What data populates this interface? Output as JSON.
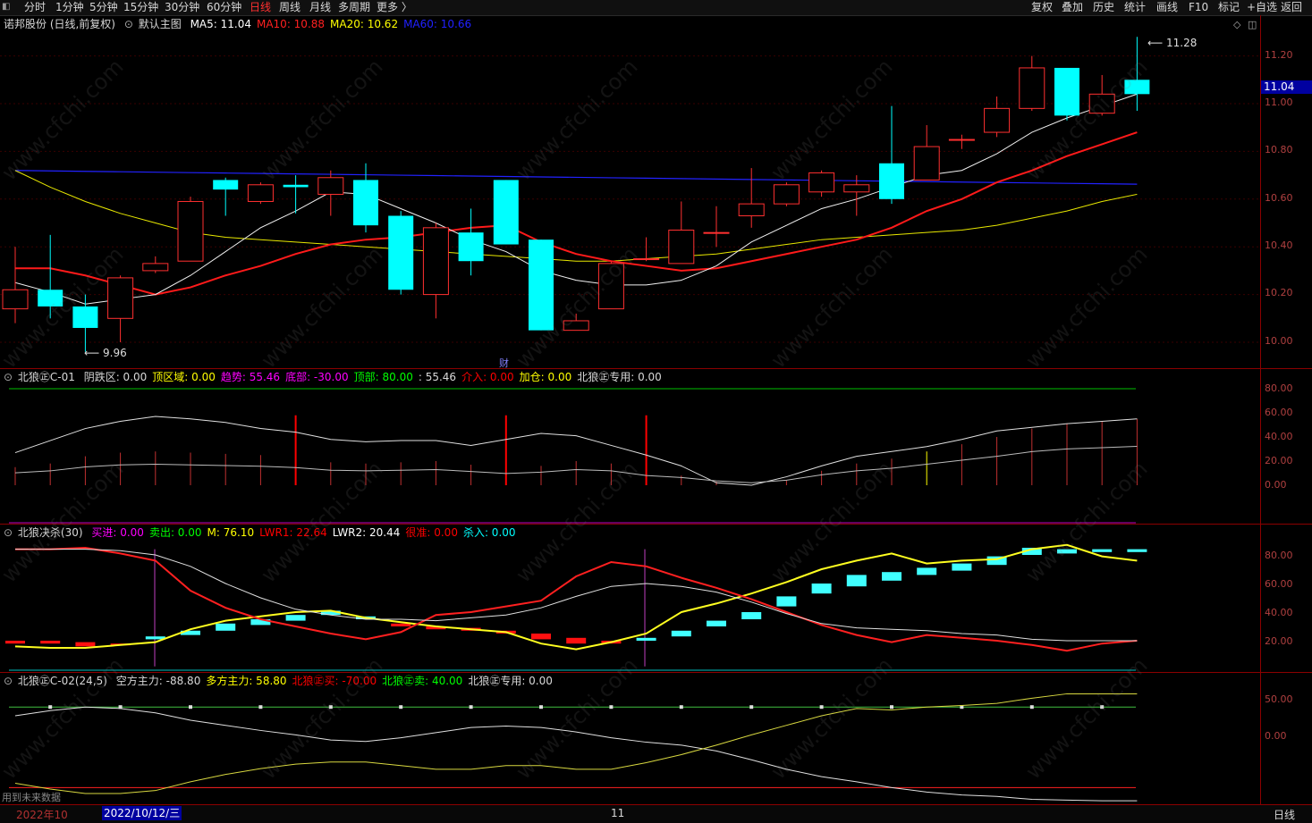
{
  "toolbar": {
    "periods": [
      "分时",
      "1分钟",
      "5分钟",
      "15分钟",
      "30分钟",
      "60分钟",
      "日线",
      "周线",
      "月线",
      "多周期",
      "更多 〉"
    ],
    "active_period": "日线",
    "right": [
      "复权",
      "叠加",
      "历史",
      "统计",
      "画线",
      "F10",
      "标记",
      "+自选",
      "返回"
    ]
  },
  "main": {
    "stock": "诺邦股份 (日线,前复权)",
    "template": "默认主图",
    "ma": [
      {
        "label": "MA5: 11.04",
        "color": "#ffffff"
      },
      {
        "label": "MA10: 10.88",
        "color": "#ff2020"
      },
      {
        "label": "MA20: 10.62",
        "color": "#ffff00"
      },
      {
        "label": "MA60: 10.66",
        "color": "#2020ff"
      }
    ],
    "y_ticks": [
      "11.20",
      "11.00",
      "10.80",
      "10.60",
      "10.40",
      "10.20",
      "10.00"
    ],
    "current_price": "11.04",
    "high_label": "11.28",
    "low_label": "9.96",
    "marker": "财"
  },
  "ind1": {
    "name": "北狼㊣C-01",
    "legend": [
      {
        "t": "阴跌区: 0.00",
        "c": "#d8d8d8"
      },
      {
        "t": "顶区域: 0.00",
        "c": "#ffff00"
      },
      {
        "t": "趋势: 55.46",
        "c": "#ff00ff"
      },
      {
        "t": "底部: -30.00",
        "c": "#ff00ff"
      },
      {
        "t": "顶部: 80.00",
        "c": "#00ff00"
      },
      {
        "t": ": 55.46",
        "c": "#d8d8d8"
      },
      {
        "t": "介入: 0.00",
        "c": "#ff0000"
      },
      {
        "t": "加仓: 0.00",
        "c": "#ffff00"
      },
      {
        "t": "北狼㊣专用: 0.00",
        "c": "#d8d8d8"
      }
    ],
    "y_ticks": [
      "80.00",
      "60.00",
      "40.00",
      "20.00",
      "0.00"
    ]
  },
  "ind2": {
    "name": "北狼决杀(30)",
    "legend": [
      {
        "t": "买进: 0.00",
        "c": "#ff00ff"
      },
      {
        "t": "卖出: 0.00",
        "c": "#00ff00"
      },
      {
        "t": "M: 76.10",
        "c": "#ffff00"
      },
      {
        "t": "LWR1: 22.64",
        "c": "#ff0000"
      },
      {
        "t": "LWR2: 20.44",
        "c": "#ffffff"
      },
      {
        "t": "很准: 0.00",
        "c": "#ff0000"
      },
      {
        "t": "杀入: 0.00",
        "c": "#00ffff"
      }
    ],
    "y_ticks": [
      "80.00",
      "60.00",
      "40.00",
      "20.00"
    ]
  },
  "ind3": {
    "name": "北狼㊣C-02(24,5)",
    "legend": [
      {
        "t": "空方主力: -88.80",
        "c": "#d8d8d8"
      },
      {
        "t": "多方主力: 58.80",
        "c": "#ffff00"
      },
      {
        "t": "北狼㊣买: -70.00",
        "c": "#ff0000"
      },
      {
        "t": "北狼㊣卖: 40.00",
        "c": "#00ff00"
      },
      {
        "t": "北狼㊣专用: 0.00",
        "c": "#d8d8d8"
      }
    ],
    "y_ticks": [
      "50.00",
      "0.00"
    ],
    "note": "用到未来数据"
  },
  "bottom": {
    "year": "2022年10",
    "date": "2022/10/12/三",
    "month_mark": "11",
    "period": "日线"
  },
  "watermark": "www.cfchi.com",
  "chart_data": {
    "type": "candlestick",
    "candles": [
      {
        "o": 10.14,
        "c": 10.22,
        "h": 10.4,
        "l": 10.08
      },
      {
        "o": 10.22,
        "c": 10.15,
        "h": 10.45,
        "l": 10.1
      },
      {
        "o": 10.15,
        "c": 10.06,
        "h": 10.2,
        "l": 9.96
      },
      {
        "o": 10.1,
        "c": 10.27,
        "h": 10.28,
        "l": 10.0
      },
      {
        "o": 10.3,
        "c": 10.33,
        "h": 10.36,
        "l": 10.29
      },
      {
        "o": 10.34,
        "c": 10.59,
        "h": 10.61,
        "l": 10.34
      },
      {
        "o": 10.68,
        "c": 10.64,
        "h": 10.69,
        "l": 10.53
      },
      {
        "o": 10.59,
        "c": 10.66,
        "h": 10.67,
        "l": 10.58
      },
      {
        "o": 10.66,
        "c": 10.65,
        "h": 10.7,
        "l": 10.54
      },
      {
        "o": 10.62,
        "c": 10.69,
        "h": 10.72,
        "l": 10.53
      },
      {
        "o": 10.68,
        "c": 10.49,
        "h": 10.75,
        "l": 10.46
      },
      {
        "o": 10.53,
        "c": 10.22,
        "h": 10.55,
        "l": 10.2
      },
      {
        "o": 10.2,
        "c": 10.48,
        "h": 10.5,
        "l": 10.1
      },
      {
        "o": 10.46,
        "c": 10.34,
        "h": 10.56,
        "l": 10.28
      },
      {
        "o": 10.68,
        "c": 10.41,
        "h": 10.68,
        "l": 10.41
      },
      {
        "o": 10.43,
        "c": 10.05,
        "h": 10.43,
        "l": 10.05
      },
      {
        "o": 10.05,
        "c": 10.09,
        "h": 10.12,
        "l": 10.05
      },
      {
        "o": 10.14,
        "c": 10.33,
        "h": 10.34,
        "l": 10.14
      },
      {
        "o": 10.35,
        "c": 10.35,
        "h": 10.44,
        "l": 10.34
      },
      {
        "o": 10.33,
        "c": 10.47,
        "h": 10.59,
        "l": 10.33
      },
      {
        "o": 10.46,
        "c": 10.46,
        "h": 10.57,
        "l": 10.4
      },
      {
        "o": 10.53,
        "c": 10.58,
        "h": 10.73,
        "l": 10.48
      },
      {
        "o": 10.58,
        "c": 10.66,
        "h": 10.67,
        "l": 10.57
      },
      {
        "o": 10.63,
        "c": 10.71,
        "h": 10.72,
        "l": 10.61
      },
      {
        "o": 10.63,
        "c": 10.66,
        "h": 10.7,
        "l": 10.53
      },
      {
        "o": 10.75,
        "c": 10.6,
        "h": 10.99,
        "l": 10.58
      },
      {
        "o": 10.68,
        "c": 10.82,
        "h": 10.91,
        "l": 10.68
      },
      {
        "o": 10.85,
        "c": 10.85,
        "h": 10.87,
        "l": 10.81
      },
      {
        "o": 10.88,
        "c": 10.98,
        "h": 11.03,
        "l": 10.86
      },
      {
        "o": 10.98,
        "c": 11.15,
        "h": 11.2,
        "l": 10.97
      },
      {
        "o": 11.15,
        "c": 10.95,
        "h": 11.15,
        "l": 10.93
      },
      {
        "o": 10.96,
        "c": 11.04,
        "h": 11.12,
        "l": 10.95
      },
      {
        "o": 11.1,
        "c": 11.04,
        "h": 11.28,
        "l": 10.97
      }
    ]
  }
}
